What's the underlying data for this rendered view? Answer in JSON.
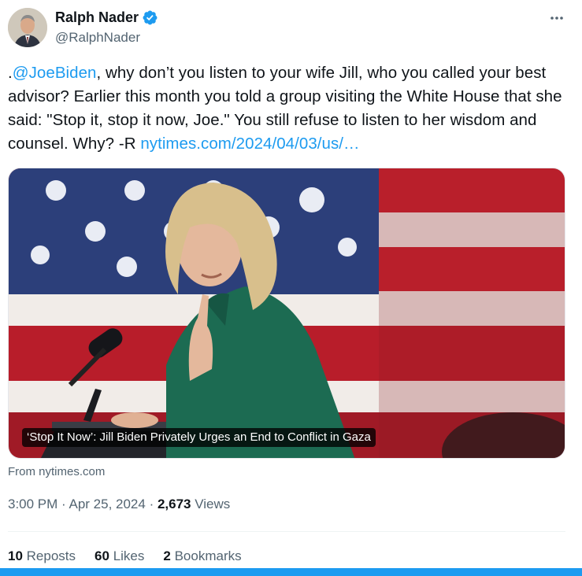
{
  "author": {
    "display_name": "Ralph Nader",
    "handle": "@RalphNader",
    "verified_color": "#1d9bf0"
  },
  "tweet": {
    "prefix": ".",
    "mention": "@JoeBiden",
    "body": ", why don’t you listen to your wife Jill, who you called your best advisor? Earlier this month you told a group visiting the White House that she said: \"Stop it, stop it now, Joe.\" You still refuse to listen to her wisdom and counsel. Why? -R ",
    "link": "nytimes.com/2024/04/03/us/…"
  },
  "card": {
    "caption": "‘Stop It Now’: Jill Biden Privately Urges an End to Conflict in Gaza",
    "source": "From nytimes.com"
  },
  "meta": {
    "time": "3:00 PM",
    "date": "Apr 25, 2024",
    "separator": " · ",
    "views_count": "2,673",
    "views_label": " Views"
  },
  "stats": {
    "reposts_count": "10",
    "reposts_label": "Reposts",
    "likes_count": "60",
    "likes_label": "Likes",
    "bookmarks_count": "2",
    "bookmarks_label": "Bookmarks"
  },
  "colors": {
    "link": "#1d9bf0",
    "secondary_text": "#536471",
    "primary_text": "#0f1419"
  }
}
